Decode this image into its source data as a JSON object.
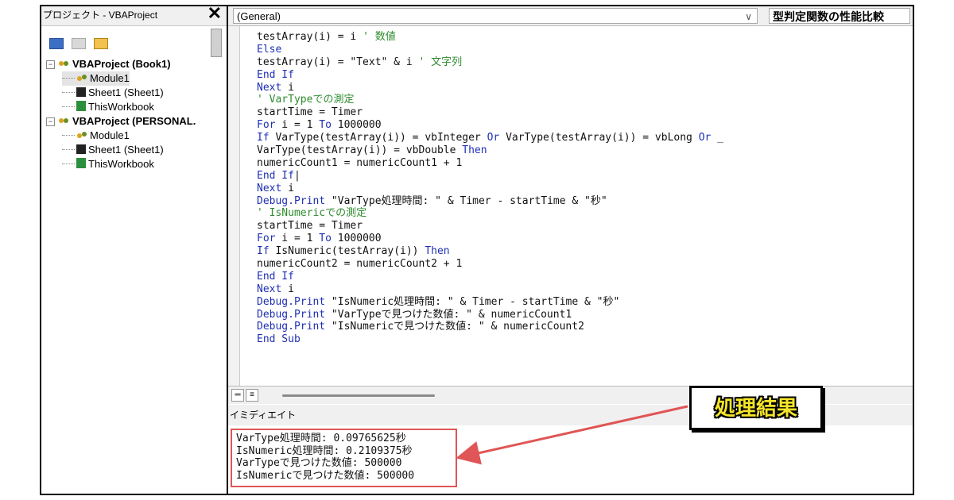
{
  "project_explorer": {
    "title": "プロジェクト - VBAProject",
    "close_glyph": "✕",
    "tree": [
      {
        "label": "VBAProject (Book1)",
        "level": 0
      },
      {
        "label": "Module1",
        "level": 1
      },
      {
        "label": "Sheet1 (Sheet1)",
        "level": 1
      },
      {
        "label": "ThisWorkbook",
        "level": 1
      },
      {
        "label": "VBAProject (PERSONAL.",
        "level": 0
      },
      {
        "label": "Module1",
        "level": 1
      },
      {
        "label": "Sheet1 (Sheet1)",
        "level": 1
      },
      {
        "label": "ThisWorkbook",
        "level": 1
      }
    ]
  },
  "editor": {
    "object_dropdown": "(General)",
    "procedure_dropdown": "型判定関数の性能比較",
    "lines": [
      "testArray(i) = i ' 数値",
      "Else",
      "testArray(i) = \"Text\" & i ' 文字列",
      "End If",
      "Next i",
      "' VarTypeでの測定",
      "startTime = Timer",
      "For i = 1 To 1000000",
      "If VarType(testArray(i)) = vbInteger Or VarType(testArray(i)) = vbLong Or _",
      "VarType(testArray(i)) = vbDouble Then",
      "numericCount1 = numericCount1 + 1",
      "End If|",
      "Next i",
      "Debug.Print \"VarType処理時間: \" & Timer - startTime & \"秒\"",
      "' IsNumericでの測定",
      "startTime = Timer",
      "For i = 1 To 1000000",
      "If IsNumeric(testArray(i)) Then",
      "numericCount2 = numericCount2 + 1",
      "End If",
      "Next i",
      "Debug.Print \"IsNumeric処理時間: \" & Timer - startTime & \"秒\"",
      "Debug.Print \"VarTypeで見つけた数値: \" & numericCount1",
      "Debug.Print \"IsNumericで見つけた数値: \" & numericCount2",
      "End Sub"
    ]
  },
  "immediate": {
    "title": "イミディエイト",
    "output": [
      "VarType処理時間: 0.09765625秒",
      "IsNumeric処理時間: 0.2109375秒",
      "VarTypeで見つけた数値: 500000",
      "IsNumericで見つけた数値: 500000"
    ]
  },
  "callout": {
    "label": "処理結果"
  },
  "colors": {
    "keyword": "#1f2fb5",
    "comment": "#2e8b2e",
    "highlight": "#e05555",
    "callout_text": "#f5e52a"
  }
}
